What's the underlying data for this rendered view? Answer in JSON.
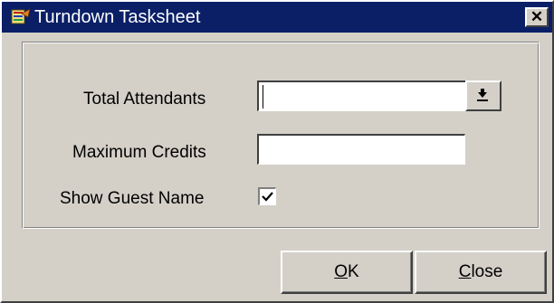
{
  "window": {
    "title": "Turndown Tasksheet",
    "close_glyph": "✕"
  },
  "form": {
    "total_attendants": {
      "label": "Total Attendants",
      "value": ""
    },
    "maximum_credits": {
      "label": "Maximum Credits",
      "value": ""
    },
    "show_guest_name": {
      "label": "Show Guest Name",
      "checked": true
    }
  },
  "buttons": {
    "ok": {
      "accesskey": "O",
      "rest": "K"
    },
    "close": {
      "accesskey": "C",
      "rest": "lose"
    }
  },
  "icons": {
    "app": "app-icon",
    "dropdown": "dropdown-arrow-icon",
    "check": "checkmark-icon"
  },
  "colors": {
    "titlebar": "#0a1f66",
    "dialog_face": "#d4d0c8"
  }
}
